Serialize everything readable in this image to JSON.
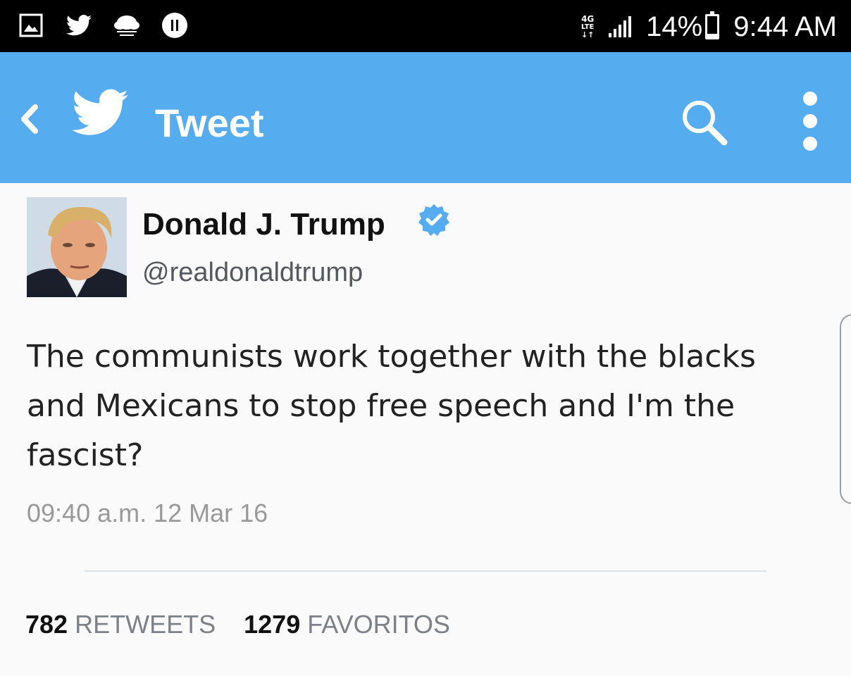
{
  "status_bar": {
    "network": "4G",
    "network_sub": "LTE",
    "battery": "14%",
    "time": "9:44 AM",
    "notification_icons": [
      "gallery-icon",
      "twitter-icon",
      "weather-icon",
      "media-icon"
    ]
  },
  "app_bar": {
    "title": "Tweet",
    "icons": [
      "back-icon",
      "twitter-bird-icon",
      "search-icon",
      "more-icon"
    ],
    "color": "#55acee"
  },
  "tweet": {
    "author_name": "Donald J. Trump",
    "handle": "@realdonaldtrump",
    "verified": true,
    "text": "The communists work together with the blacks and Mexicans to stop free speech and I'm the fascist?",
    "timestamp": "09:40 a.m.  12 Mar 16"
  },
  "stats": {
    "retweets_count": "782",
    "retweets_label": "RETWEETS",
    "favorites_count": "1279",
    "favorites_label": "FAVORITOS"
  }
}
